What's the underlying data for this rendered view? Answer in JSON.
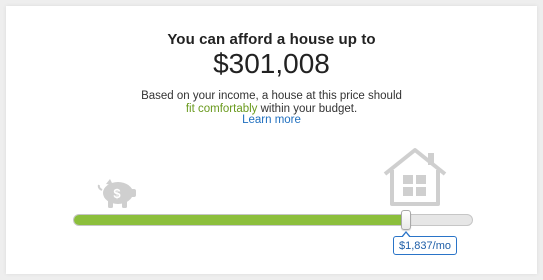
{
  "headline": "You can afford a house up to",
  "amount": "$301,008",
  "description": {
    "line1": "Based on your income, a house at this price should",
    "highlight": "fit comfortably",
    "line2_rest": " within your budget."
  },
  "learn_more": "Learn more",
  "slider": {
    "value_fraction": 0.835,
    "tooltip": "$1,837/mo"
  },
  "colors": {
    "accent_green": "#8cbf3c",
    "highlight_text": "#6a9a1e",
    "link_blue": "#1f6fbf",
    "icon_gray": "#cfcfcf"
  },
  "icons": {
    "left": "piggy-bank-dollar-icon",
    "right": "house-icon"
  }
}
